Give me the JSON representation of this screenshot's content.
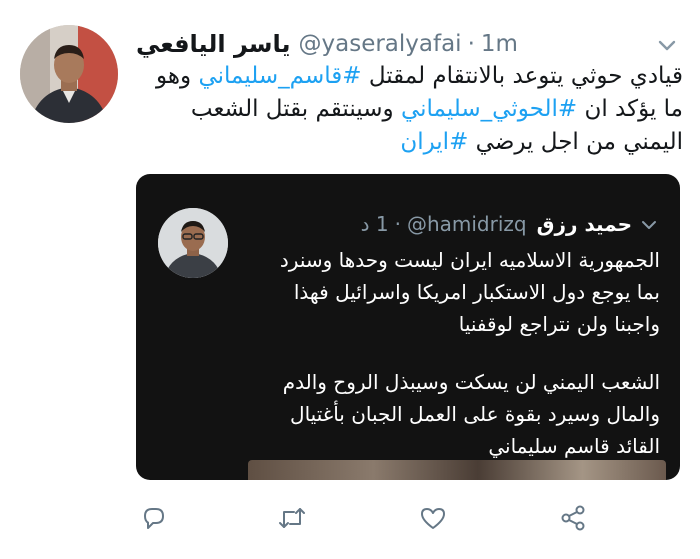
{
  "tweet": {
    "name": "ياسر اليافعي",
    "handle": "@yaseralyafai",
    "separator": "·",
    "time": "1m",
    "text_segments": [
      {
        "text": "قيادي حوثي يتوعد بالانتقام لمقتل ",
        "hashtag": false
      },
      {
        "text": "#قاسم_سليماني",
        "hashtag": true
      },
      {
        "text": " وهو ما يؤكد ان ",
        "hashtag": false
      },
      {
        "text": "#الحوثي_سليماني",
        "hashtag": true
      },
      {
        "text": " وسينتقم بقتل الشعب اليمني من اجل يرضي ",
        "hashtag": false
      },
      {
        "text": "#ايران",
        "hashtag": true
      }
    ]
  },
  "embedded": {
    "name": "حميد رزق",
    "handle": "@hamidrizq",
    "separator": "·",
    "time": "1 د",
    "paragraphs": [
      "الجمهورية الاسلاميه ايران ليست وحدها وسنرد بما يوجع دول الاستكبار امريكا واسرائيل فهذا واجبنا ولن نتراجع لوقفنيا",
      "الشعب اليمني لن يسكت وسيبذل الروح والدم والمال وسيرد بقوة على العمل الجبان بأغتيال القائد قاسم سليماني"
    ]
  },
  "icons": {
    "reply": "reply-icon",
    "retweet": "retweet-icon",
    "like": "like-icon",
    "share": "share-icon",
    "caret": "chevron-down-icon"
  },
  "colors": {
    "hashtag": "#1da1f2",
    "secondary_text": "#657786",
    "action_icon": "#657786",
    "embed_background": "#121212"
  }
}
